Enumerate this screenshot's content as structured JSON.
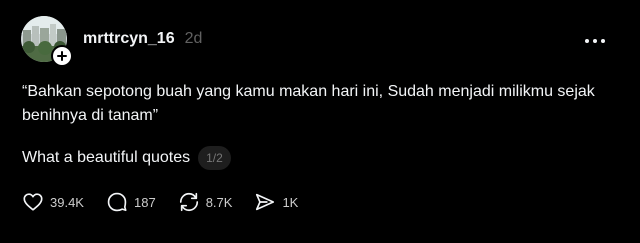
{
  "post": {
    "username": "mrttrcyn_16",
    "timestamp": "2d",
    "text": "“Bahkan sepotong buah yang kamu makan hari ini, Sudah menjadi milikmu sejak benihnya di tanam”",
    "caption": "What a beautiful quotes",
    "page_indicator": "1/2"
  },
  "actions": {
    "likes": "39.4K",
    "replies": "187",
    "reposts": "8.7K",
    "shares": "1K"
  },
  "icons": {
    "like": "heart-icon",
    "reply": "speech-bubble-icon",
    "repost": "repost-arrows-icon",
    "share": "send-icon",
    "more": "more-horizontal-icon",
    "follow": "plus-icon"
  },
  "colors": {
    "background": "#000000",
    "text_primary": "#f3f5f7",
    "text_secondary": "#616161",
    "pill_background": "#1e1e1e"
  }
}
